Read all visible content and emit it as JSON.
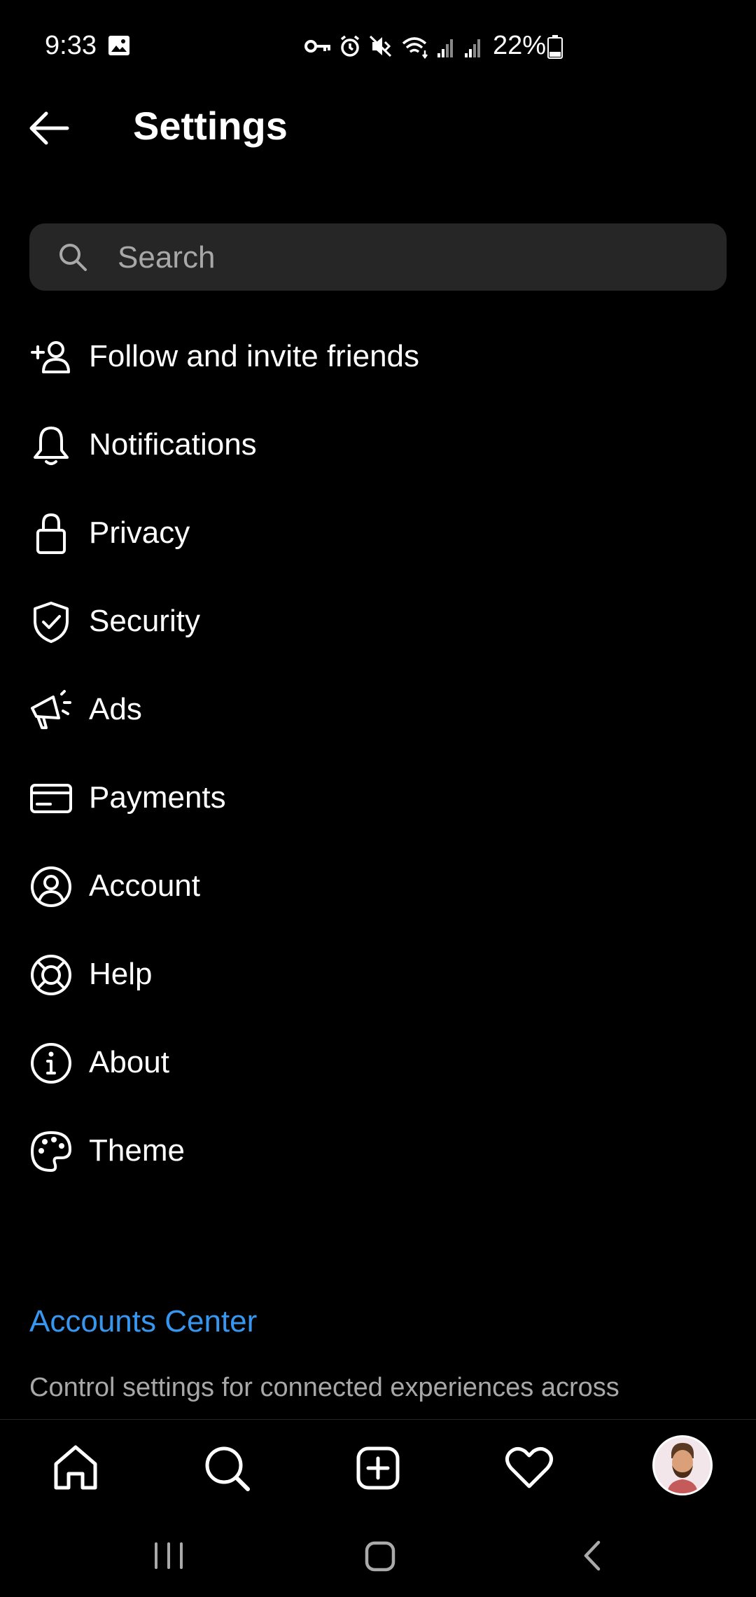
{
  "status_bar": {
    "time": "9:33",
    "battery": "22%",
    "icons": [
      "gallery-icon",
      "vpn-key-icon",
      "alarm-icon",
      "mute-icon",
      "wifi-icon",
      "signal-icon",
      "signal-icon",
      "battery-icon"
    ]
  },
  "header": {
    "title": "Settings",
    "back_icon": "arrow-left-icon"
  },
  "search": {
    "placeholder": "Search",
    "value": ""
  },
  "menu": [
    {
      "label": "Follow and invite friends",
      "icon": "add-person-icon"
    },
    {
      "label": "Notifications",
      "icon": "bell-icon"
    },
    {
      "label": "Privacy",
      "icon": "lock-icon"
    },
    {
      "label": "Security",
      "icon": "shield-check-icon"
    },
    {
      "label": "Ads",
      "icon": "megaphone-icon"
    },
    {
      "label": "Payments",
      "icon": "credit-card-icon"
    },
    {
      "label": "Account",
      "icon": "user-circle-icon"
    },
    {
      "label": "Help",
      "icon": "lifebuoy-icon"
    },
    {
      "label": "About",
      "icon": "info-icon"
    },
    {
      "label": "Theme",
      "icon": "palette-icon"
    }
  ],
  "accounts_center": {
    "link": "Accounts Center",
    "description": "Control settings for connected experiences across"
  },
  "bottom_nav": [
    "home-icon",
    "search-icon",
    "create-icon",
    "heart-icon",
    "avatar"
  ],
  "system_nav": [
    "recents-icon",
    "home-icon",
    "back-icon"
  ],
  "colors": {
    "background": "#000000",
    "search_bg": "#262626",
    "link": "#3797f0",
    "muted": "#a8a8a8"
  }
}
